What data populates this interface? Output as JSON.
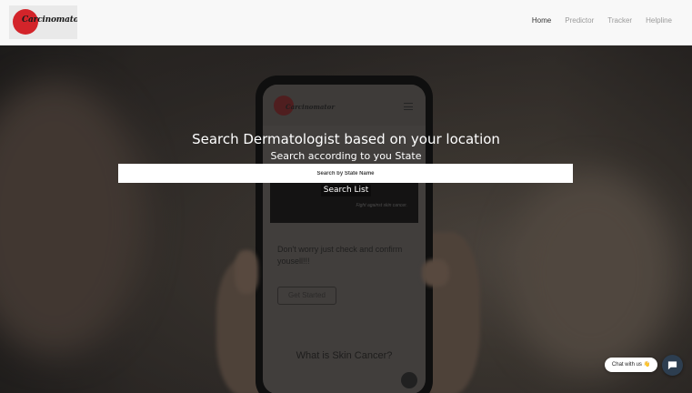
{
  "header": {
    "logo_text": "Carcinomator",
    "logo_initial": "C",
    "nav": [
      {
        "label": "Home",
        "active": true
      },
      {
        "label": "Predictor",
        "active": false
      },
      {
        "label": "Tracker",
        "active": false
      },
      {
        "label": "Helpline",
        "active": false
      }
    ]
  },
  "hero": {
    "title": "Search Dermatologist based on your location",
    "subtitle": "Search according to you State",
    "search_placeholder": "Search by State Name",
    "search_button": "Search List"
  },
  "phone_mockup": {
    "logo_text": "Carcinomator",
    "banner_text": "Fight against skin cancer.",
    "body_text": "Don't worry just check and confirm yousell!!!",
    "button_label": "Get Started",
    "heading": "What is Skin Cancer?"
  },
  "chat": {
    "label": "Chat with us 👋",
    "icon": "chat-bubble-icon"
  },
  "colors": {
    "brand_red": "#d3242a",
    "chat_button": "#2d3e50"
  }
}
